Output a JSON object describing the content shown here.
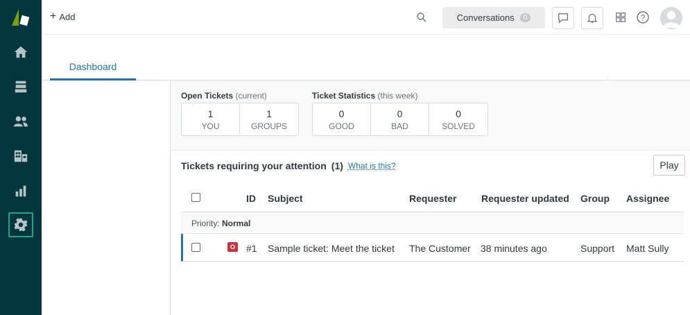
{
  "topbar": {
    "add_label": "Add",
    "conversations_label": "Conversations",
    "conversations_count": "0"
  },
  "tabs": [
    {
      "label": "Dashboard",
      "active": true
    }
  ],
  "stats": {
    "open_title": "Open Tickets",
    "open_qualifier": "(current)",
    "open_cells": [
      {
        "value": "1",
        "label": "YOU"
      },
      {
        "value": "1",
        "label": "GROUPS"
      }
    ],
    "stats_title": "Ticket Statistics",
    "stats_qualifier": "(this week)",
    "stats_cells": [
      {
        "value": "0",
        "label": "GOOD"
      },
      {
        "value": "0",
        "label": "BAD"
      },
      {
        "value": "0",
        "label": "SOLVED"
      }
    ]
  },
  "tickets": {
    "heading": "Tickets requiring your attention",
    "count": "(1)",
    "what_link": "What is this?",
    "play_label": "Play",
    "columns": {
      "id": "ID",
      "subject": "Subject",
      "requester": "Requester",
      "requester_updated": "Requester updated",
      "group": "Group",
      "assignee": "Assignee"
    },
    "group_prefix": "Priority:",
    "group_value": "Normal",
    "rows": [
      {
        "status": "O",
        "id": "#1",
        "subject": "Sample ticket: Meet the ticket",
        "requester": "The Customer",
        "requester_updated": "38 minutes ago",
        "group": "Support",
        "assignee": "Matt Sully"
      }
    ]
  },
  "colors": {
    "sidebar_bg": "#03363d",
    "accent": "#1f73b7",
    "active_nav_border": "#17a88a",
    "status_open": "#cc3340"
  },
  "icons": {
    "sidebar": [
      "home-icon",
      "views-icon",
      "customers-icon",
      "organizations-icon",
      "reporting-icon",
      "admin-gear-icon"
    ],
    "topbar": [
      "search-icon",
      "chat-icon",
      "notifications-bell-icon",
      "products-grid-icon",
      "help-icon",
      "avatar"
    ]
  }
}
